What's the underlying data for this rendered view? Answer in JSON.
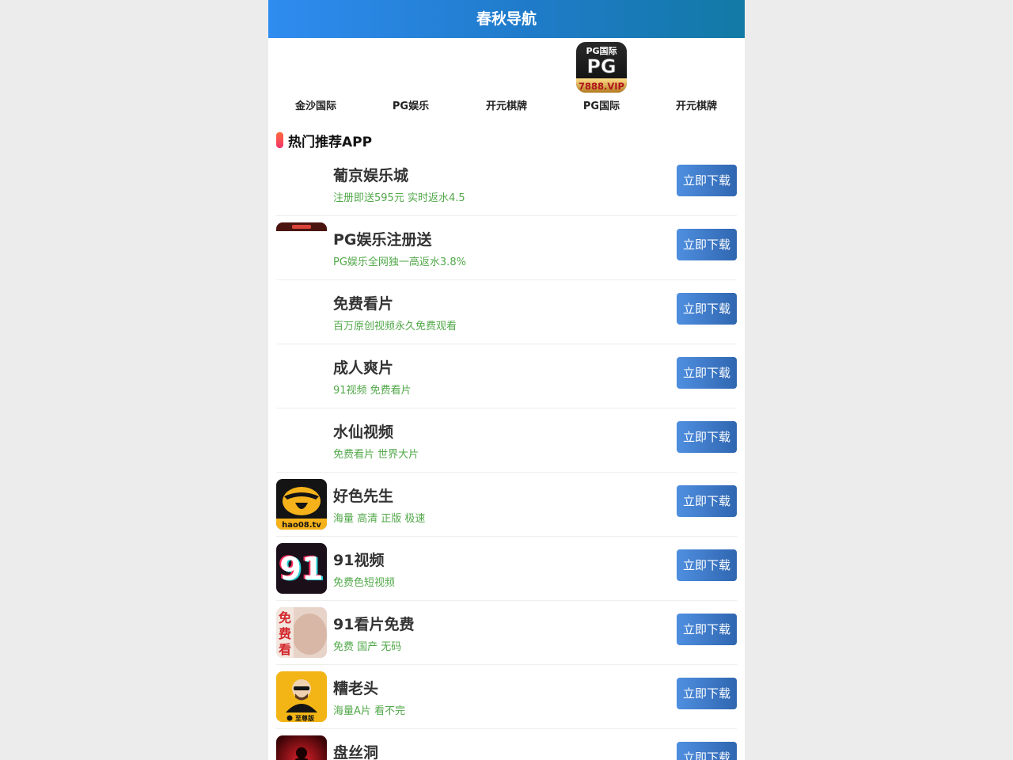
{
  "header": {
    "title": "春秋导航"
  },
  "quick_nav": [
    {
      "label": "金沙国际",
      "icon": "blank"
    },
    {
      "label": "PG娱乐",
      "icon": "blank"
    },
    {
      "label": "开元棋牌",
      "icon": "blank"
    },
    {
      "label": "PG国际",
      "icon": "pg-logo-icon",
      "icon_top_text": "PG国际",
      "icon_mid_text": "PG",
      "icon_bottom_text": "7888.VIP"
    },
    {
      "label": "开元棋牌",
      "icon": "blank"
    }
  ],
  "section": {
    "title": "热门推荐APP"
  },
  "apps": [
    {
      "name": "葡京娱乐城",
      "desc": "注册即送595元 实时返水4.5",
      "button": "立即下载",
      "icon": "blank"
    },
    {
      "name": "PG娱乐注册送",
      "desc": "PG娱乐全网独一高返水3.8%",
      "button": "立即下载",
      "icon": "pg-thumb-icon"
    },
    {
      "name": "免费看片",
      "desc": "百万原创视频永久免费观看",
      "button": "立即下载",
      "icon": "blank"
    },
    {
      "name": "成人爽片",
      "desc": "91视频 免费看片",
      "button": "立即下载",
      "icon": "blank"
    },
    {
      "name": "水仙视频",
      "desc": "免费看片 世界大片",
      "button": "立即下载",
      "icon": "blank"
    },
    {
      "name": "好色先生",
      "desc": "海量 高清 正版 极速",
      "button": "立即下载",
      "icon": "hao08-icon",
      "icon_text": "hao08.tv"
    },
    {
      "name": "91视频",
      "desc": "免费色短视频",
      "button": "立即下载",
      "icon": "video91-icon",
      "icon_text": "91"
    },
    {
      "name": "91看片免费",
      "desc": "免费 国产 无码",
      "button": "立即下载",
      "icon": "free-watch-icon",
      "icon_text": "免费看"
    },
    {
      "name": "糟老头",
      "desc": "海量A片 看不完",
      "button": "立即下载",
      "icon": "old-man-icon",
      "icon_text": "至尊版"
    },
    {
      "name": "盘丝洞",
      "desc": "",
      "button": "立即下载",
      "icon": "pansidong-icon"
    }
  ],
  "colors": {
    "header_gradient_start": "#2f8cf0",
    "header_gradient_end": "#127aa5",
    "desc_green": "#52a84a",
    "button_blue": "#3a78c8"
  }
}
